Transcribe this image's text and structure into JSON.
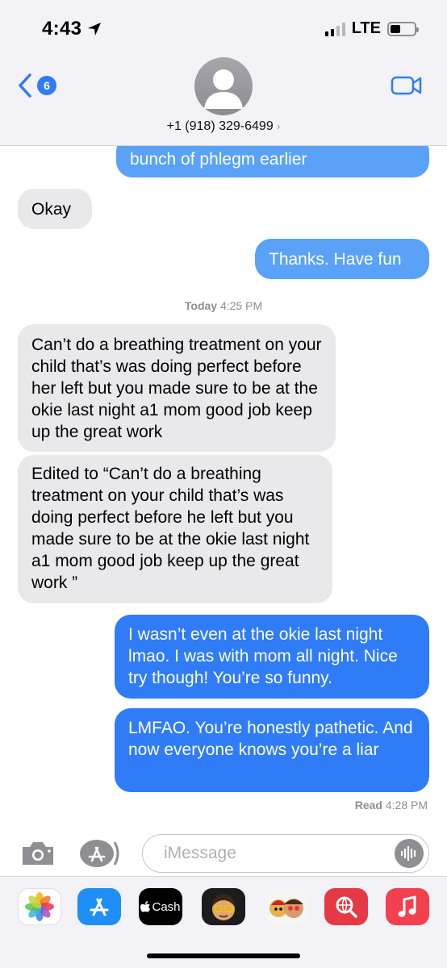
{
  "status": {
    "time": "4:43",
    "network": "LTE"
  },
  "header": {
    "back_count": "6",
    "contact_number": "+1 (918) 329-6499",
    "chevron": "›"
  },
  "messages": [
    {
      "direction": "out",
      "text": "bunch of phlegm earlier"
    },
    {
      "direction": "in",
      "text": "Okay"
    },
    {
      "direction": "out",
      "text": "Thanks. Have fun"
    },
    {
      "direction": "in",
      "text": "Can’t do a breathing treatment on your child that’s was doing perfect before her left but you made sure to be at the okie last night a1 mom good job keep up the great work"
    },
    {
      "direction": "in",
      "text": "Edited to “Can’t do a breathing treatment on your child that’s was doing perfect before he left but you made sure to be at the okie last night a1 mom good job keep up the great work ”"
    },
    {
      "direction": "out",
      "text": "I wasn’t even at the okie last night lmao. I was with mom all night. Nice try though! You’re so funny."
    },
    {
      "direction": "out",
      "text": "LMFAO. You’re honestly pathetic. And now everyone knows you’re a liar"
    }
  ],
  "timestamp": {
    "day": "Today",
    "time": "4:25 PM"
  },
  "receipt": {
    "label": "Read",
    "time": "4:28 PM"
  },
  "composer": {
    "placeholder": "iMessage"
  },
  "drawer": {
    "apps": [
      {
        "icon": "photos-icon"
      },
      {
        "icon": "app-store-icon"
      },
      {
        "icon": "apple-cash-icon",
        "label": "Cash"
      },
      {
        "icon": "memoji-icon"
      },
      {
        "icon": "animoji-stickers-icon"
      },
      {
        "icon": "web-search-icon"
      },
      {
        "icon": "music-icon"
      }
    ]
  },
  "colors": {
    "blue": "#2f7cf6",
    "light_blue": "#5aa2f8",
    "gray_bubble": "#e9e9eb",
    "header_bg": "#f2f2f7"
  }
}
